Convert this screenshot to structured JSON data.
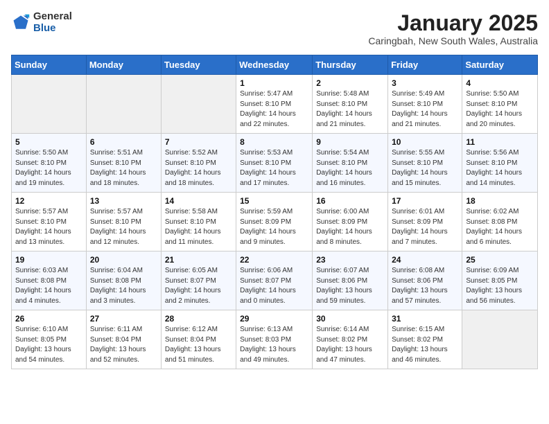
{
  "logo": {
    "general": "General",
    "blue": "Blue"
  },
  "title": "January 2025",
  "subtitle": "Caringbah, New South Wales, Australia",
  "headers": [
    "Sunday",
    "Monday",
    "Tuesday",
    "Wednesday",
    "Thursday",
    "Friday",
    "Saturday"
  ],
  "weeks": [
    [
      {
        "day": "",
        "info": ""
      },
      {
        "day": "",
        "info": ""
      },
      {
        "day": "",
        "info": ""
      },
      {
        "day": "1",
        "info": "Sunrise: 5:47 AM\nSunset: 8:10 PM\nDaylight: 14 hours\nand 22 minutes."
      },
      {
        "day": "2",
        "info": "Sunrise: 5:48 AM\nSunset: 8:10 PM\nDaylight: 14 hours\nand 21 minutes."
      },
      {
        "day": "3",
        "info": "Sunrise: 5:49 AM\nSunset: 8:10 PM\nDaylight: 14 hours\nand 21 minutes."
      },
      {
        "day": "4",
        "info": "Sunrise: 5:50 AM\nSunset: 8:10 PM\nDaylight: 14 hours\nand 20 minutes."
      }
    ],
    [
      {
        "day": "5",
        "info": "Sunrise: 5:50 AM\nSunset: 8:10 PM\nDaylight: 14 hours\nand 19 minutes."
      },
      {
        "day": "6",
        "info": "Sunrise: 5:51 AM\nSunset: 8:10 PM\nDaylight: 14 hours\nand 18 minutes."
      },
      {
        "day": "7",
        "info": "Sunrise: 5:52 AM\nSunset: 8:10 PM\nDaylight: 14 hours\nand 18 minutes."
      },
      {
        "day": "8",
        "info": "Sunrise: 5:53 AM\nSunset: 8:10 PM\nDaylight: 14 hours\nand 17 minutes."
      },
      {
        "day": "9",
        "info": "Sunrise: 5:54 AM\nSunset: 8:10 PM\nDaylight: 14 hours\nand 16 minutes."
      },
      {
        "day": "10",
        "info": "Sunrise: 5:55 AM\nSunset: 8:10 PM\nDaylight: 14 hours\nand 15 minutes."
      },
      {
        "day": "11",
        "info": "Sunrise: 5:56 AM\nSunset: 8:10 PM\nDaylight: 14 hours\nand 14 minutes."
      }
    ],
    [
      {
        "day": "12",
        "info": "Sunrise: 5:57 AM\nSunset: 8:10 PM\nDaylight: 14 hours\nand 13 minutes."
      },
      {
        "day": "13",
        "info": "Sunrise: 5:57 AM\nSunset: 8:10 PM\nDaylight: 14 hours\nand 12 minutes."
      },
      {
        "day": "14",
        "info": "Sunrise: 5:58 AM\nSunset: 8:10 PM\nDaylight: 14 hours\nand 11 minutes."
      },
      {
        "day": "15",
        "info": "Sunrise: 5:59 AM\nSunset: 8:09 PM\nDaylight: 14 hours\nand 9 minutes."
      },
      {
        "day": "16",
        "info": "Sunrise: 6:00 AM\nSunset: 8:09 PM\nDaylight: 14 hours\nand 8 minutes."
      },
      {
        "day": "17",
        "info": "Sunrise: 6:01 AM\nSunset: 8:09 PM\nDaylight: 14 hours\nand 7 minutes."
      },
      {
        "day": "18",
        "info": "Sunrise: 6:02 AM\nSunset: 8:08 PM\nDaylight: 14 hours\nand 6 minutes."
      }
    ],
    [
      {
        "day": "19",
        "info": "Sunrise: 6:03 AM\nSunset: 8:08 PM\nDaylight: 14 hours\nand 4 minutes."
      },
      {
        "day": "20",
        "info": "Sunrise: 6:04 AM\nSunset: 8:08 PM\nDaylight: 14 hours\nand 3 minutes."
      },
      {
        "day": "21",
        "info": "Sunrise: 6:05 AM\nSunset: 8:07 PM\nDaylight: 14 hours\nand 2 minutes."
      },
      {
        "day": "22",
        "info": "Sunrise: 6:06 AM\nSunset: 8:07 PM\nDaylight: 14 hours\nand 0 minutes."
      },
      {
        "day": "23",
        "info": "Sunrise: 6:07 AM\nSunset: 8:06 PM\nDaylight: 13 hours\nand 59 minutes."
      },
      {
        "day": "24",
        "info": "Sunrise: 6:08 AM\nSunset: 8:06 PM\nDaylight: 13 hours\nand 57 minutes."
      },
      {
        "day": "25",
        "info": "Sunrise: 6:09 AM\nSunset: 8:05 PM\nDaylight: 13 hours\nand 56 minutes."
      }
    ],
    [
      {
        "day": "26",
        "info": "Sunrise: 6:10 AM\nSunset: 8:05 PM\nDaylight: 13 hours\nand 54 minutes."
      },
      {
        "day": "27",
        "info": "Sunrise: 6:11 AM\nSunset: 8:04 PM\nDaylight: 13 hours\nand 52 minutes."
      },
      {
        "day": "28",
        "info": "Sunrise: 6:12 AM\nSunset: 8:04 PM\nDaylight: 13 hours\nand 51 minutes."
      },
      {
        "day": "29",
        "info": "Sunrise: 6:13 AM\nSunset: 8:03 PM\nDaylight: 13 hours\nand 49 minutes."
      },
      {
        "day": "30",
        "info": "Sunrise: 6:14 AM\nSunset: 8:02 PM\nDaylight: 13 hours\nand 47 minutes."
      },
      {
        "day": "31",
        "info": "Sunrise: 6:15 AM\nSunset: 8:02 PM\nDaylight: 13 hours\nand 46 minutes."
      },
      {
        "day": "",
        "info": ""
      }
    ]
  ]
}
